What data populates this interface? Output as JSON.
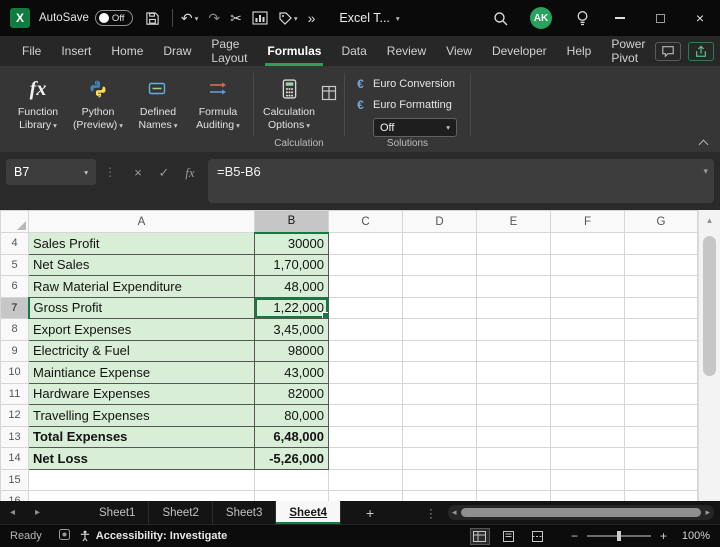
{
  "titlebar": {
    "autosave_label": "AutoSave",
    "autosave_state": "Off",
    "doc_title": "Excel T...",
    "avatar_initials": "AK"
  },
  "icons": {
    "dropdown": "▾",
    "undo": "↶",
    "redo": "↷",
    "cut": "✂",
    "overflow": "»",
    "dots": "⋮",
    "cancel": "×",
    "enter": "✓",
    "fx": "fx",
    "euro": "€",
    "close": "×",
    "zoom_out": "−",
    "zoom_in": "+",
    "nav_left": "◂",
    "nav_right": "▸",
    "up": "▴"
  },
  "ribbon_tabs": {
    "items": [
      {
        "label": "File"
      },
      {
        "label": "Insert"
      },
      {
        "label": "Home"
      },
      {
        "label": "Draw"
      },
      {
        "label": "Page Layout"
      },
      {
        "label": "Formulas"
      },
      {
        "label": "Data"
      },
      {
        "label": "Review"
      },
      {
        "label": "View"
      },
      {
        "label": "Developer"
      },
      {
        "label": "Help"
      },
      {
        "label": "Power Pivot"
      }
    ],
    "active": "Formulas"
  },
  "ribbon": {
    "function_library": "Function Library",
    "python_preview": "Python (Preview)",
    "defined_names": "Defined Names",
    "formula_auditing": "Formula Auditing",
    "calculation_options": "Calculation Options",
    "calculation_group": "Calculation",
    "solutions_group": "Solutions",
    "euro_conversion": "Euro Conversion",
    "euro_formatting": "Euro Formatting",
    "solutions_dropdown": "Off"
  },
  "formula_bar": {
    "name_box": "B7",
    "formula": "=B5-B6"
  },
  "grid": {
    "columns": [
      "A",
      "B",
      "C",
      "D",
      "E",
      "F",
      "G"
    ],
    "selected_cell": "B7",
    "rows": [
      {
        "n": "4",
        "a": "Sales Profit",
        "b": "30000"
      },
      {
        "n": "5",
        "a": "Net Sales",
        "b": "1,70,000"
      },
      {
        "n": "6",
        "a": "Raw Material Expenditure",
        "b": "48,000"
      },
      {
        "n": "7",
        "a": "Gross Profit",
        "b": "1,22,000"
      },
      {
        "n": "8",
        "a": "Export Expenses",
        "b": "3,45,000"
      },
      {
        "n": "9",
        "a": "Electricity & Fuel",
        "b": "98000"
      },
      {
        "n": "10",
        "a": "Maintiance Expense",
        "b": "43,000"
      },
      {
        "n": "11",
        "a": "Hardware Expenses",
        "b": "82000"
      },
      {
        "n": "12",
        "a": "Travelling Expenses",
        "b": "80,000"
      },
      {
        "n": "13",
        "a": "Total Expenses",
        "b": "6,48,000"
      },
      {
        "n": "14",
        "a": "Net Loss",
        "b": "-5,26,000"
      },
      {
        "n": "15",
        "a": "",
        "b": ""
      },
      {
        "n": "16",
        "a": "",
        "b": ""
      }
    ]
  },
  "sheetbar": {
    "tabs": [
      {
        "name": "Sheet1"
      },
      {
        "name": "Sheet2"
      },
      {
        "name": "Sheet3"
      },
      {
        "name": "Sheet4"
      }
    ],
    "active": "Sheet4",
    "add_label": "+"
  },
  "statusbar": {
    "mode": "Ready",
    "accessibility": "Accessibility: Investigate",
    "zoom": "100%"
  }
}
